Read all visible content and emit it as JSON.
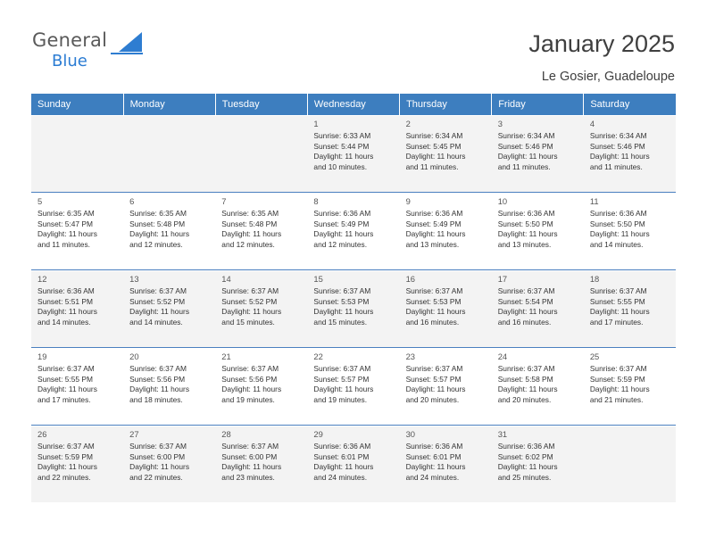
{
  "logo": {
    "general": "General",
    "blue": "Blue"
  },
  "header": {
    "title": "January 2025",
    "location": "Le Gosier, Guadeloupe"
  },
  "calendar": {
    "weekdays": [
      "Sunday",
      "Monday",
      "Tuesday",
      "Wednesday",
      "Thursday",
      "Friday",
      "Saturday"
    ],
    "weeks": [
      [
        {
          "day": ""
        },
        {
          "day": ""
        },
        {
          "day": ""
        },
        {
          "day": "1",
          "sunrise": "Sunrise: 6:33 AM",
          "sunset": "Sunset: 5:44 PM",
          "daylight1": "Daylight: 11 hours",
          "daylight2": "and 10 minutes."
        },
        {
          "day": "2",
          "sunrise": "Sunrise: 6:34 AM",
          "sunset": "Sunset: 5:45 PM",
          "daylight1": "Daylight: 11 hours",
          "daylight2": "and 11 minutes."
        },
        {
          "day": "3",
          "sunrise": "Sunrise: 6:34 AM",
          "sunset": "Sunset: 5:46 PM",
          "daylight1": "Daylight: 11 hours",
          "daylight2": "and 11 minutes."
        },
        {
          "day": "4",
          "sunrise": "Sunrise: 6:34 AM",
          "sunset": "Sunset: 5:46 PM",
          "daylight1": "Daylight: 11 hours",
          "daylight2": "and 11 minutes."
        }
      ],
      [
        {
          "day": "5",
          "sunrise": "Sunrise: 6:35 AM",
          "sunset": "Sunset: 5:47 PM",
          "daylight1": "Daylight: 11 hours",
          "daylight2": "and 11 minutes."
        },
        {
          "day": "6",
          "sunrise": "Sunrise: 6:35 AM",
          "sunset": "Sunset: 5:48 PM",
          "daylight1": "Daylight: 11 hours",
          "daylight2": "and 12 minutes."
        },
        {
          "day": "7",
          "sunrise": "Sunrise: 6:35 AM",
          "sunset": "Sunset: 5:48 PM",
          "daylight1": "Daylight: 11 hours",
          "daylight2": "and 12 minutes."
        },
        {
          "day": "8",
          "sunrise": "Sunrise: 6:36 AM",
          "sunset": "Sunset: 5:49 PM",
          "daylight1": "Daylight: 11 hours",
          "daylight2": "and 12 minutes."
        },
        {
          "day": "9",
          "sunrise": "Sunrise: 6:36 AM",
          "sunset": "Sunset: 5:49 PM",
          "daylight1": "Daylight: 11 hours",
          "daylight2": "and 13 minutes."
        },
        {
          "day": "10",
          "sunrise": "Sunrise: 6:36 AM",
          "sunset": "Sunset: 5:50 PM",
          "daylight1": "Daylight: 11 hours",
          "daylight2": "and 13 minutes."
        },
        {
          "day": "11",
          "sunrise": "Sunrise: 6:36 AM",
          "sunset": "Sunset: 5:50 PM",
          "daylight1": "Daylight: 11 hours",
          "daylight2": "and 14 minutes."
        }
      ],
      [
        {
          "day": "12",
          "sunrise": "Sunrise: 6:36 AM",
          "sunset": "Sunset: 5:51 PM",
          "daylight1": "Daylight: 11 hours",
          "daylight2": "and 14 minutes."
        },
        {
          "day": "13",
          "sunrise": "Sunrise: 6:37 AM",
          "sunset": "Sunset: 5:52 PM",
          "daylight1": "Daylight: 11 hours",
          "daylight2": "and 14 minutes."
        },
        {
          "day": "14",
          "sunrise": "Sunrise: 6:37 AM",
          "sunset": "Sunset: 5:52 PM",
          "daylight1": "Daylight: 11 hours",
          "daylight2": "and 15 minutes."
        },
        {
          "day": "15",
          "sunrise": "Sunrise: 6:37 AM",
          "sunset": "Sunset: 5:53 PM",
          "daylight1": "Daylight: 11 hours",
          "daylight2": "and 15 minutes."
        },
        {
          "day": "16",
          "sunrise": "Sunrise: 6:37 AM",
          "sunset": "Sunset: 5:53 PM",
          "daylight1": "Daylight: 11 hours",
          "daylight2": "and 16 minutes."
        },
        {
          "day": "17",
          "sunrise": "Sunrise: 6:37 AM",
          "sunset": "Sunset: 5:54 PM",
          "daylight1": "Daylight: 11 hours",
          "daylight2": "and 16 minutes."
        },
        {
          "day": "18",
          "sunrise": "Sunrise: 6:37 AM",
          "sunset": "Sunset: 5:55 PM",
          "daylight1": "Daylight: 11 hours",
          "daylight2": "and 17 minutes."
        }
      ],
      [
        {
          "day": "19",
          "sunrise": "Sunrise: 6:37 AM",
          "sunset": "Sunset: 5:55 PM",
          "daylight1": "Daylight: 11 hours",
          "daylight2": "and 17 minutes."
        },
        {
          "day": "20",
          "sunrise": "Sunrise: 6:37 AM",
          "sunset": "Sunset: 5:56 PM",
          "daylight1": "Daylight: 11 hours",
          "daylight2": "and 18 minutes."
        },
        {
          "day": "21",
          "sunrise": "Sunrise: 6:37 AM",
          "sunset": "Sunset: 5:56 PM",
          "daylight1": "Daylight: 11 hours",
          "daylight2": "and 19 minutes."
        },
        {
          "day": "22",
          "sunrise": "Sunrise: 6:37 AM",
          "sunset": "Sunset: 5:57 PM",
          "daylight1": "Daylight: 11 hours",
          "daylight2": "and 19 minutes."
        },
        {
          "day": "23",
          "sunrise": "Sunrise: 6:37 AM",
          "sunset": "Sunset: 5:57 PM",
          "daylight1": "Daylight: 11 hours",
          "daylight2": "and 20 minutes."
        },
        {
          "day": "24",
          "sunrise": "Sunrise: 6:37 AM",
          "sunset": "Sunset: 5:58 PM",
          "daylight1": "Daylight: 11 hours",
          "daylight2": "and 20 minutes."
        },
        {
          "day": "25",
          "sunrise": "Sunrise: 6:37 AM",
          "sunset": "Sunset: 5:59 PM",
          "daylight1": "Daylight: 11 hours",
          "daylight2": "and 21 minutes."
        }
      ],
      [
        {
          "day": "26",
          "sunrise": "Sunrise: 6:37 AM",
          "sunset": "Sunset: 5:59 PM",
          "daylight1": "Daylight: 11 hours",
          "daylight2": "and 22 minutes."
        },
        {
          "day": "27",
          "sunrise": "Sunrise: 6:37 AM",
          "sunset": "Sunset: 6:00 PM",
          "daylight1": "Daylight: 11 hours",
          "daylight2": "and 22 minutes."
        },
        {
          "day": "28",
          "sunrise": "Sunrise: 6:37 AM",
          "sunset": "Sunset: 6:00 PM",
          "daylight1": "Daylight: 11 hours",
          "daylight2": "and 23 minutes."
        },
        {
          "day": "29",
          "sunrise": "Sunrise: 6:36 AM",
          "sunset": "Sunset: 6:01 PM",
          "daylight1": "Daylight: 11 hours",
          "daylight2": "and 24 minutes."
        },
        {
          "day": "30",
          "sunrise": "Sunrise: 6:36 AM",
          "sunset": "Sunset: 6:01 PM",
          "daylight1": "Daylight: 11 hours",
          "daylight2": "and 24 minutes."
        },
        {
          "day": "31",
          "sunrise": "Sunrise: 6:36 AM",
          "sunset": "Sunset: 6:02 PM",
          "daylight1": "Daylight: 11 hours",
          "daylight2": "and 25 minutes."
        },
        {
          "day": ""
        }
      ]
    ]
  }
}
